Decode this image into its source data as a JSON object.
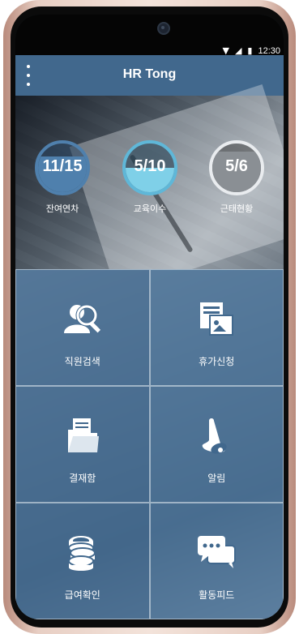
{
  "status_bar": {
    "time": "12:30"
  },
  "app_bar": {
    "title": "HR Tong"
  },
  "stats": [
    {
      "value": "11/15",
      "label": "잔여연차",
      "fill": 0.73
    },
    {
      "value": "5/10",
      "label": "교육이수",
      "fill": 0.5
    },
    {
      "value": "5/6",
      "label": "근태현황",
      "fill": 0.83
    }
  ],
  "colors": {
    "appbar": "#41688d",
    "ring_blue": "#4f80ad",
    "ring_cyan": "#5fb7d8",
    "ring_gray": "#8a8f94"
  },
  "menu": [
    {
      "label": "직원검색",
      "icon": "employee-search-icon"
    },
    {
      "label": "휴가신청",
      "icon": "vacation-request-icon"
    },
    {
      "label": "결재함",
      "icon": "approval-box-icon"
    },
    {
      "label": "알림",
      "icon": "bell-icon"
    },
    {
      "label": "급여확인",
      "icon": "coins-icon"
    },
    {
      "label": "활동피드",
      "icon": "chat-bubbles-icon"
    }
  ]
}
